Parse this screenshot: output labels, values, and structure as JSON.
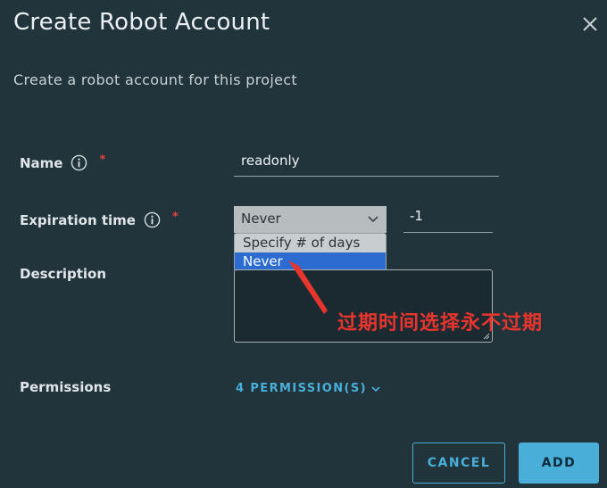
{
  "dialog": {
    "title": "Create Robot Account",
    "subtitle": "Create a robot account for this project"
  },
  "fields": {
    "name": {
      "label": "Name",
      "required_mark": "*",
      "value": "readonly"
    },
    "expiration": {
      "label": "Expiration time",
      "required_mark": "*",
      "selected": "Never",
      "options": [
        "Specify # of days",
        "Never"
      ],
      "days_value": "-1"
    },
    "description": {
      "label": "Description",
      "value": ""
    },
    "permissions": {
      "label": "Permissions",
      "link_text": "4 PERMISSION(S)"
    }
  },
  "buttons": {
    "cancel": "CANCEL",
    "add": "ADD"
  },
  "annotation": {
    "text": "过期时间选择永不过期",
    "color": "#e8352e"
  },
  "colors": {
    "background": "#21333b",
    "accent": "#49afd9",
    "selection": "#2c6bd0"
  },
  "icons": {
    "close": "close-icon",
    "info": "info-icon",
    "chevron": "chevron-down-icon"
  }
}
